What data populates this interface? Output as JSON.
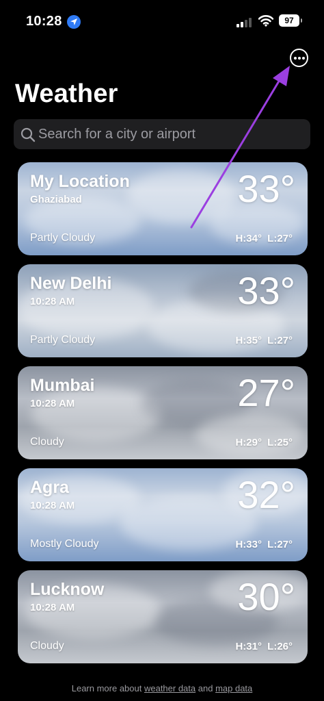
{
  "status": {
    "time": "10:28",
    "battery": "97"
  },
  "header": {
    "title": "Weather"
  },
  "search": {
    "placeholder": "Search for a city or airport"
  },
  "cards": [
    {
      "name": "My Location",
      "sub": "Ghaziabad",
      "temp": "33°",
      "condition": "Partly Cloudy",
      "high": "H:34°",
      "low": "L:27°"
    },
    {
      "name": "New Delhi",
      "sub": "10:28 AM",
      "temp": "33°",
      "condition": "Partly Cloudy",
      "high": "H:35°",
      "low": "L:27°"
    },
    {
      "name": "Mumbai",
      "sub": "10:28 AM",
      "temp": "27°",
      "condition": "Cloudy",
      "high": "H:29°",
      "low": "L:25°"
    },
    {
      "name": "Agra",
      "sub": "10:28 AM",
      "temp": "32°",
      "condition": "Mostly Cloudy",
      "high": "H:33°",
      "low": "L:27°"
    },
    {
      "name": "Lucknow",
      "sub": "10:28 AM",
      "temp": "30°",
      "condition": "Cloudy",
      "high": "H:31°",
      "low": "L:26°"
    }
  ],
  "footer": {
    "prefix": "Learn more about ",
    "link1": "weather data",
    "middle": " and ",
    "link2": "map data"
  },
  "icons": {
    "location": "location-arrow-icon",
    "more": "ellipsis-circle-icon",
    "search": "magnifier-icon"
  },
  "colors": {
    "accent": "#2f7bf6",
    "annotation_arrow": "#9b3fe0"
  }
}
